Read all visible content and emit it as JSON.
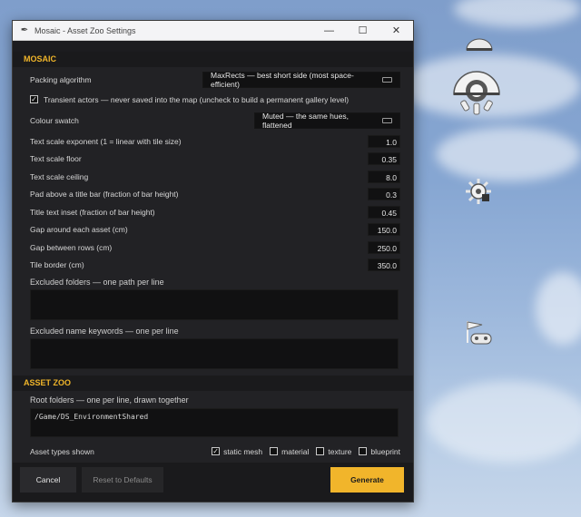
{
  "window": {
    "title": "Mosaic - Asset Zoo Settings",
    "controls": {
      "minimize": "—",
      "maximize": "☐",
      "close": "✕"
    }
  },
  "mosaic": {
    "header": "MOSAIC",
    "packing_label": "Packing algorithm",
    "packing_value": "MaxRects — best short side (most space-efficient)",
    "transient_checked": true,
    "transient_label": "Transient actors — never saved into the map (uncheck to build a permanent gallery level)",
    "swatch_label": "Colour swatch",
    "swatch_value": "Muted — the same hues, flattened",
    "fields": [
      {
        "label": "Text scale exponent (1 = linear with tile size)",
        "value": "1.0"
      },
      {
        "label": "Text scale floor",
        "value": "0.35"
      },
      {
        "label": "Text scale ceiling",
        "value": "8.0"
      },
      {
        "label": "Pad above a title bar (fraction of bar height)",
        "value": "0.3"
      },
      {
        "label": "Title text inset (fraction of bar height)",
        "value": "0.45"
      },
      {
        "label": "Gap around each asset (cm)",
        "value": "150.0"
      },
      {
        "label": "Gap between rows (cm)",
        "value": "250.0"
      },
      {
        "label": "Tile border (cm)",
        "value": "350.0"
      }
    ],
    "excluded_folders_label": "Excluded folders — one path per line",
    "excluded_folders_value": "",
    "excluded_keywords_label": "Excluded name keywords — one per line",
    "excluded_keywords_value": ""
  },
  "zoo": {
    "header": "ASSET ZOO",
    "roots_label": "Root folders — one per line, drawn together",
    "roots_value": "/Game/DS_EnvironmentShared",
    "types_label": "Asset types shown",
    "types": [
      {
        "label": "static mesh",
        "checked": true
      },
      {
        "label": "material",
        "checked": false
      },
      {
        "label": "texture",
        "checked": false
      },
      {
        "label": "blueprint",
        "checked": false
      }
    ]
  },
  "footer": {
    "cancel": "Cancel",
    "reset": "Reset to Defaults",
    "generate": "Generate"
  },
  "colors": {
    "accent": "#f0b52a",
    "generate_bg": "#f1b52b",
    "panel": "#222225"
  },
  "viewport_icons": [
    "dome-icon",
    "sky-light-icon",
    "sun-light-icon",
    "player-start-icon"
  ]
}
